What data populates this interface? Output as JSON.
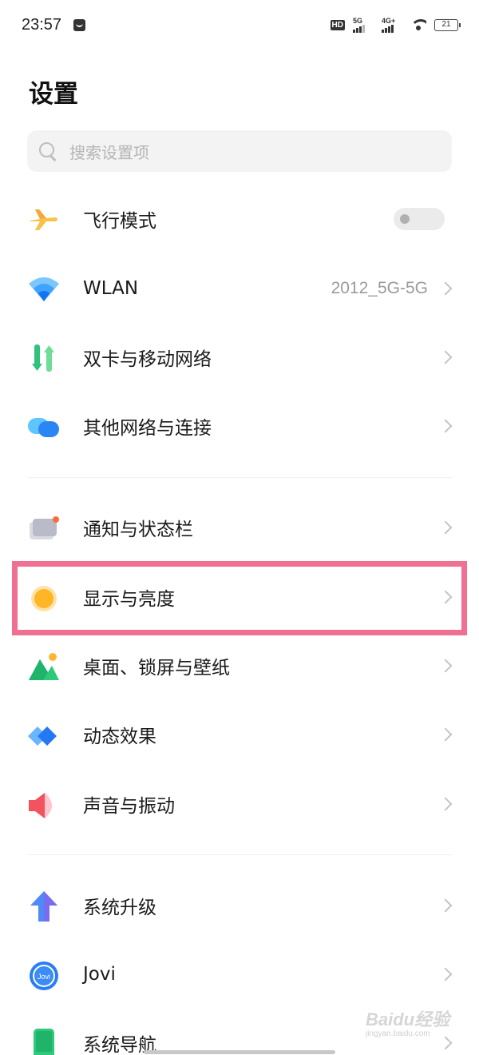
{
  "status_bar": {
    "time": "23:57",
    "hd_label": "HD",
    "sim1_type": "5G",
    "sim2_type": "4G+",
    "battery": "21"
  },
  "page": {
    "title": "设置"
  },
  "search": {
    "placeholder": "搜索设置项"
  },
  "groups": [
    {
      "items": [
        {
          "label": "飞行模式",
          "icon": "airplane-icon",
          "control": "toggle",
          "toggle_on": false
        },
        {
          "label": "WLAN",
          "icon": "wifi-icon",
          "value": "2012_5G-5G",
          "control": "chevron"
        },
        {
          "label": "双卡与移动网络",
          "icon": "dual-sim-icon",
          "control": "chevron"
        },
        {
          "label": "其他网络与连接",
          "icon": "connection-icon",
          "control": "chevron"
        }
      ]
    },
    {
      "items": [
        {
          "label": "通知与状态栏",
          "icon": "notification-icon",
          "control": "chevron"
        },
        {
          "label": "显示与亮度",
          "icon": "brightness-icon",
          "control": "chevron",
          "highlighted": true
        },
        {
          "label": "桌面、锁屏与壁纸",
          "icon": "wallpaper-icon",
          "control": "chevron"
        },
        {
          "label": "动态效果",
          "icon": "motion-effects-icon",
          "control": "chevron"
        },
        {
          "label": "声音与振动",
          "icon": "sound-icon",
          "control": "chevron"
        }
      ]
    },
    {
      "items": [
        {
          "label": "系统升级",
          "icon": "system-update-icon",
          "control": "chevron"
        },
        {
          "label": "Jovi",
          "icon": "jovi-icon",
          "icon_text": "Jovi",
          "control": "chevron"
        },
        {
          "label": "系统导航",
          "icon": "system-navigation-icon",
          "control": "chevron"
        }
      ]
    }
  ],
  "colors": {
    "highlight_border": "#f07092",
    "accent_blue": "#2f7cf6"
  },
  "watermark": {
    "main": "Baidu经验",
    "sub": "jingyan.baidu.com"
  }
}
